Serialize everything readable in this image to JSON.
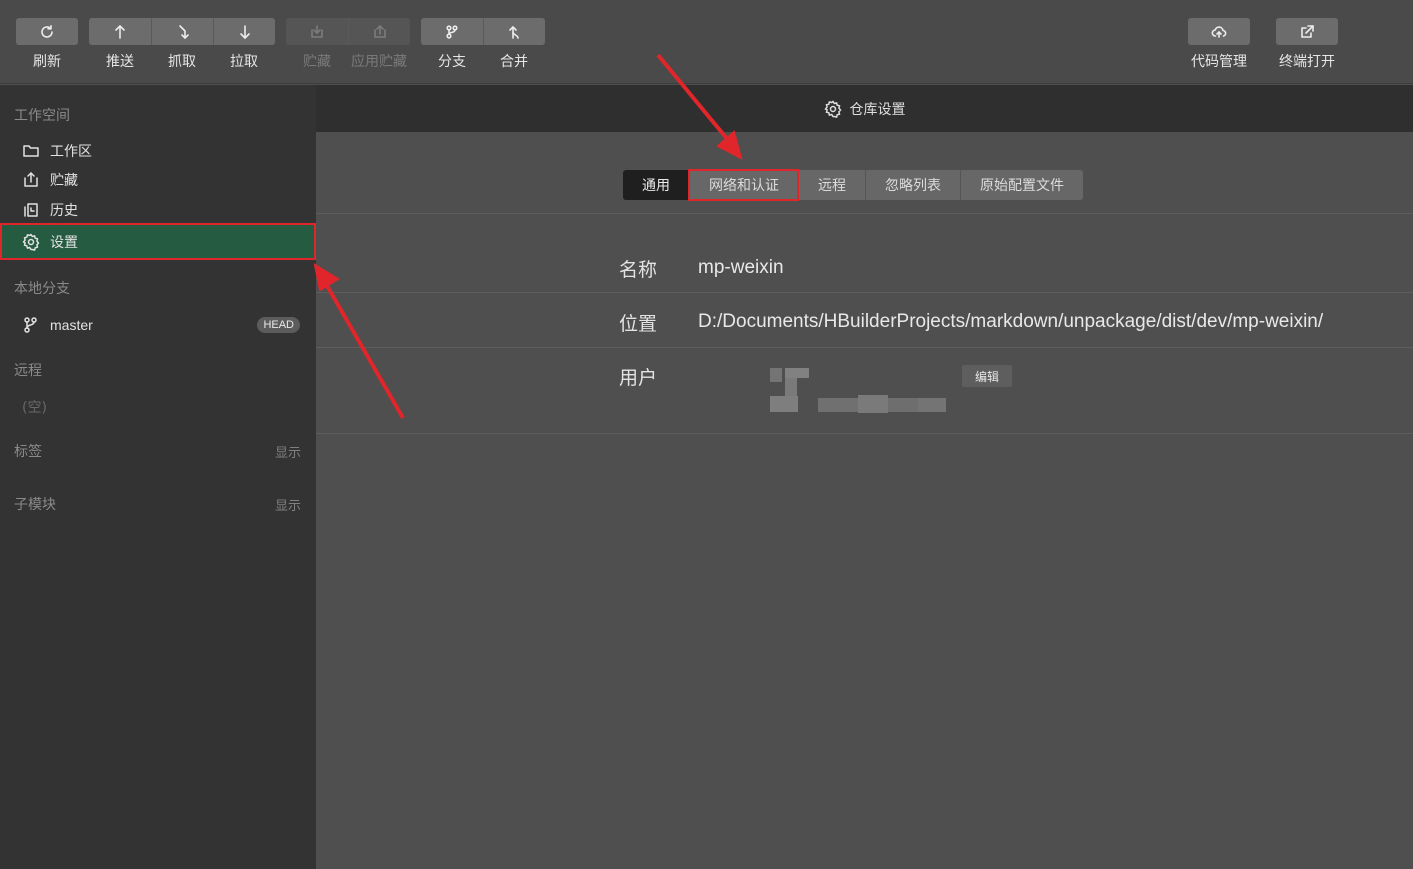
{
  "toolbar": {
    "refresh": "刷新",
    "push": "推送",
    "fetch": "抓取",
    "pull": "拉取",
    "stash": "贮藏",
    "apply_stash": "应用贮藏",
    "branch": "分支",
    "merge": "合并",
    "code_manage": "代码管理",
    "terminal_open": "终端打开"
  },
  "sidebar": {
    "workspace_title": "工作空间",
    "items": [
      {
        "label": "工作区",
        "icon": "folder-icon"
      },
      {
        "label": "贮藏",
        "icon": "stash-icon"
      },
      {
        "label": "历史",
        "icon": "history-icon"
      },
      {
        "label": "设置",
        "icon": "gear-icon"
      }
    ],
    "local_branch_title": "本地分支",
    "branch_name": "master",
    "head_badge": "HEAD",
    "remote_title": "远程",
    "remote_empty": "(空)",
    "tags_title": "标签",
    "tags_show": "显示",
    "submodule_title": "子模块",
    "submodule_show": "显示"
  },
  "main": {
    "header_title": "仓库设置",
    "tabs": [
      "通用",
      "网络和认证",
      "远程",
      "忽略列表",
      "原始配置文件"
    ],
    "selected_tab": "通用",
    "name_label": "名称",
    "name_value": "mp-weixin",
    "location_label": "位置",
    "location_value": "D:/Documents/HBuilderProjects/markdown/unpackage/dist/dev/mp-weixin/",
    "user_label": "用户",
    "edit_button": "编辑"
  },
  "colors": {
    "accent_active": "#255b40",
    "highlight_red": "#e0262a"
  }
}
